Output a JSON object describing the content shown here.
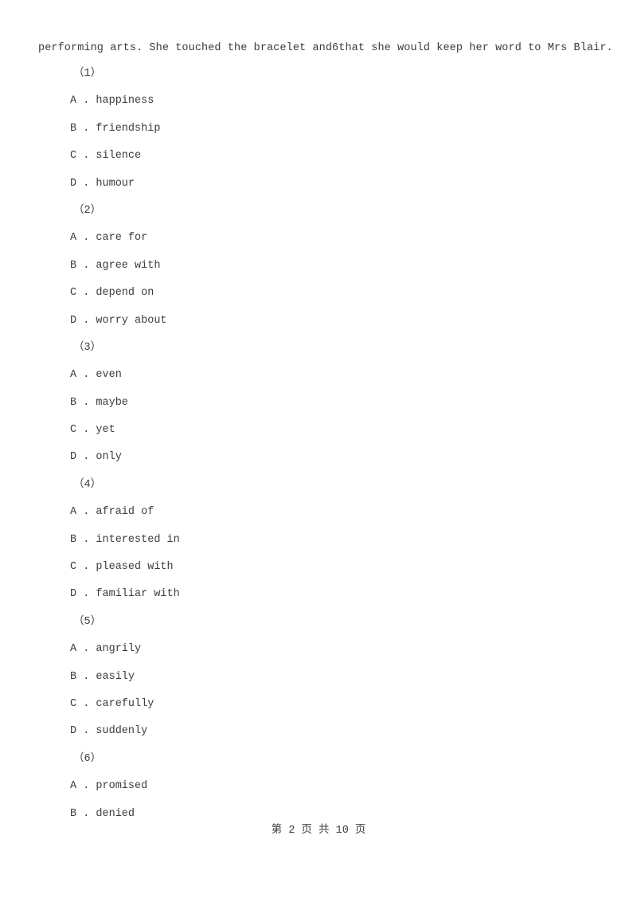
{
  "document": {
    "passage_fragment": "performing arts. She touched the bracelet and6that she would keep her word to Mrs Blair.",
    "footer": "第 2 页 共 10 页"
  },
  "questions": [
    {
      "label": "（1）",
      "options": [
        "A . happiness",
        "B . friendship",
        "C . silence",
        "D . humour"
      ]
    },
    {
      "label": "（2）",
      "options": [
        "A . care for",
        "B . agree with",
        "C . depend on",
        "D . worry about"
      ]
    },
    {
      "label": "（3）",
      "options": [
        "A . even",
        "B . maybe",
        "C . yet",
        "D . only"
      ]
    },
    {
      "label": "（4）",
      "options": [
        "A . afraid of",
        "B . interested in",
        "C . pleased with",
        "D . familiar with"
      ]
    },
    {
      "label": "（5）",
      "options": [
        "A . angrily",
        "B . easily",
        "C . carefully",
        "D . suddenly"
      ]
    },
    {
      "label": "（6）",
      "options": [
        "A . promised",
        "B . denied"
      ]
    }
  ]
}
